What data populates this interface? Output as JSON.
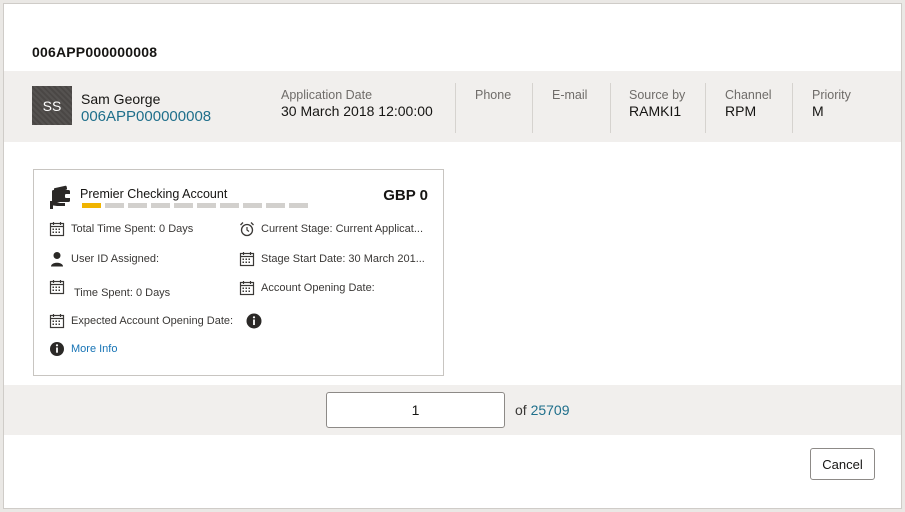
{
  "dialog": {
    "title": "006APP000000008"
  },
  "applicant": {
    "initials": "SS",
    "name": "Sam George",
    "app_id": "006APP000000008"
  },
  "meta": [
    {
      "label": "Application Date",
      "value": "30 March 2018 12:00:00"
    },
    {
      "label": "Phone",
      "value": ""
    },
    {
      "label": "E-mail",
      "value": ""
    },
    {
      "label": "Source by",
      "value": "RAMKI1"
    },
    {
      "label": "Channel",
      "value": "RPM"
    },
    {
      "label": "Priority",
      "value": "M"
    }
  ],
  "card": {
    "product": "Premier Checking Account",
    "amount": "GBP 0",
    "progress": {
      "completed_steps": 1,
      "total_steps": 10
    },
    "total_time_spent": "Total Time Spent: 0 Days",
    "current_stage": "Current Stage: Current Applicat...",
    "user_id_assigned": "User ID Assigned:",
    "stage_start_date": "Stage Start Date: 30 March 201...",
    "time_spent": "Time Spent: 0 Days",
    "account_opening_date": "Account Opening Date:",
    "expected_opening_date": "Expected Account Opening Date:",
    "more_info": "More Info"
  },
  "pager": {
    "current_page": "1",
    "of_label": "of",
    "total": "25709"
  },
  "footer": {
    "cancel_label": "Cancel"
  },
  "colors": {
    "accent_link": "#1f6f8b",
    "progress_active": "#f0b400",
    "progress_inactive": "#d2d0cd"
  },
  "icons": [
    "wallet-icon",
    "calendar-icon",
    "alarm-clock-icon",
    "user-icon",
    "info-icon"
  ]
}
